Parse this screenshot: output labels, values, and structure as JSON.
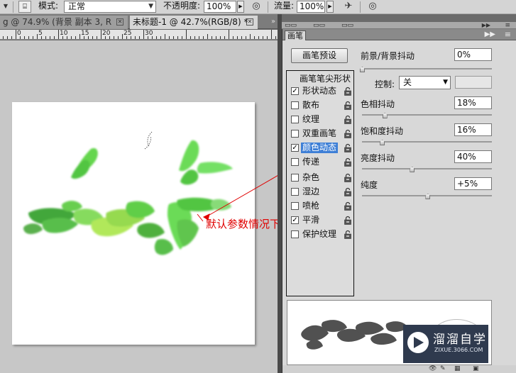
{
  "options_bar": {
    "mode_label": "模式:",
    "mode_value": "正常",
    "opacity_label": "不透明度:",
    "opacity_value": "100%",
    "flow_label": "流量:",
    "flow_value": "100%"
  },
  "tabs": [
    {
      "label": "g @ 74.9% (背景 副本 3, R",
      "active": false
    },
    {
      "label": "未标题-1 @ 42.7%(RGB/8) *",
      "active": true
    }
  ],
  "ruler": {
    "labels": [
      "0",
      "5",
      "10",
      "15",
      "20",
      "25",
      "30"
    ]
  },
  "annotation": "默认参数情况下",
  "panel": {
    "tab_label": "画笔",
    "preset_button": "画笔预设",
    "brush_tip_header": "画笔笔尖形状",
    "options": [
      {
        "label": "形状动态",
        "checked": true,
        "selected": false
      },
      {
        "label": "散布",
        "checked": false,
        "selected": false
      },
      {
        "label": "纹理",
        "checked": false,
        "selected": false
      },
      {
        "label": "双重画笔",
        "checked": false,
        "selected": false
      },
      {
        "label": "颜色动态",
        "checked": true,
        "selected": true
      },
      {
        "label": "传递",
        "checked": false,
        "selected": false
      },
      {
        "label": "杂色",
        "checked": false,
        "selected": false
      },
      {
        "label": "湿边",
        "checked": false,
        "selected": false
      },
      {
        "label": "喷枪",
        "checked": false,
        "selected": false
      },
      {
        "label": "平滑",
        "checked": true,
        "selected": false
      },
      {
        "label": "保护纹理",
        "checked": false,
        "selected": false
      }
    ],
    "fg_bg_jitter": {
      "label": "前景/背景抖动",
      "value": "0%",
      "level": 0
    },
    "control": {
      "label": "控制:",
      "value": "关"
    },
    "hue_jitter": {
      "label": "色相抖动",
      "value": "18%",
      "level": 0.18
    },
    "saturation_jitter": {
      "label": "饱和度抖动",
      "value": "16%",
      "level": 0.16
    },
    "brightness_jitter": {
      "label": "亮度抖动",
      "value": "40%",
      "level": 0.4
    },
    "purity": {
      "label": "纯度",
      "value": "+5%",
      "level": 0.525
    }
  },
  "watermark": {
    "title": "溜溜自学",
    "url": "ZIXUE.3066.COM"
  },
  "colors": {
    "selection": "#3e7fd6",
    "annotation": "#e00000",
    "brush_green": "#4fc936",
    "watermark_bg": "#2f3a4e"
  }
}
